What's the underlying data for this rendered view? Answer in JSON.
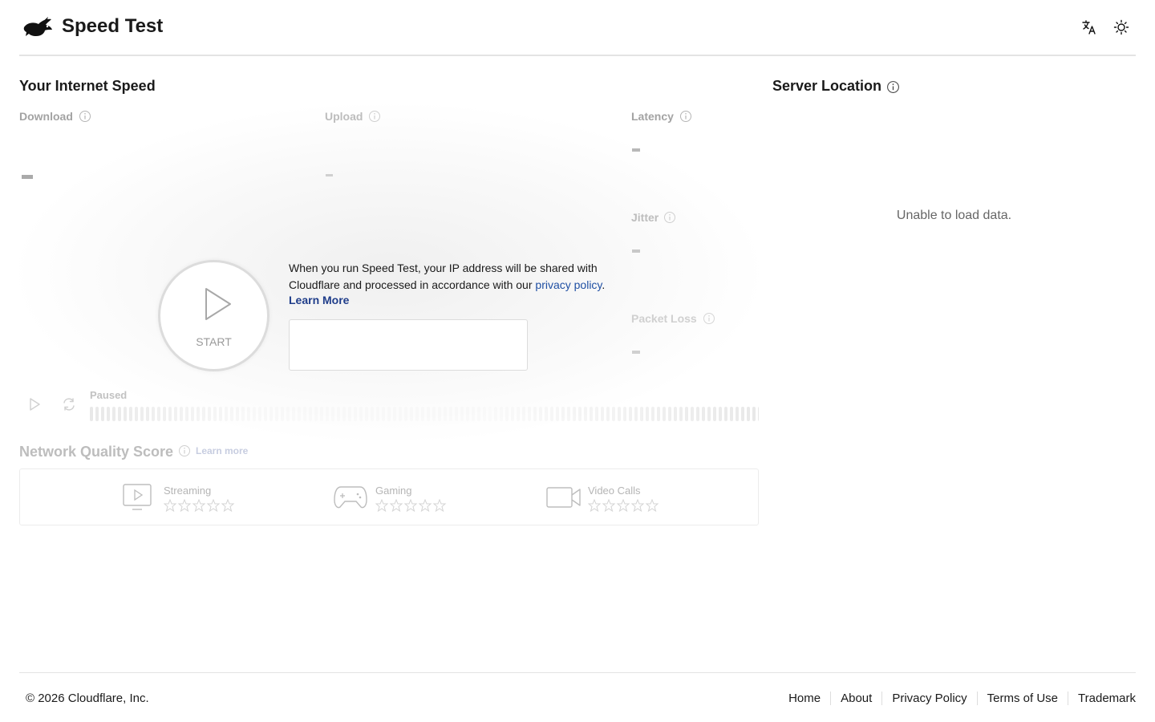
{
  "header": {
    "brand": "Speed Test",
    "logo_icon": "rabbit-logo-icon",
    "language_icon": "translate-icon",
    "theme_icon": "sun-icon"
  },
  "speed": {
    "title": "Your Internet Speed",
    "download_label": "Download",
    "upload_label": "Upload",
    "latency_label": "Latency",
    "jitter_label": "Jitter",
    "packet_loss_label": "Packet Loss",
    "start_label": "START",
    "notice_text": "When you run Speed Test, your IP address will be shared with Cloudflare and processed in accordance with our ",
    "privacy_link": "privacy policy",
    "notice_end": ".",
    "learn_more": "Learn More",
    "status": "Paused"
  },
  "network_quality": {
    "title": "Network Quality Score",
    "learn_more": "Learn more",
    "items": [
      {
        "label": "Streaming",
        "icon": "tv-play-icon"
      },
      {
        "label": "Gaming",
        "icon": "gamepad-icon"
      },
      {
        "label": "Video Calls",
        "icon": "video-camera-icon"
      }
    ]
  },
  "server": {
    "title": "Server Location",
    "message": "Unable to load data."
  },
  "footer": {
    "copyright": "© 2026 Cloudflare, Inc.",
    "links": [
      "Home",
      "About",
      "Privacy Policy",
      "Terms of Use",
      "Trademark"
    ]
  },
  "colors": {
    "link": "#1f4fa3",
    "learn_more": "#1f3d8a",
    "muted": "#a3a3a3"
  }
}
